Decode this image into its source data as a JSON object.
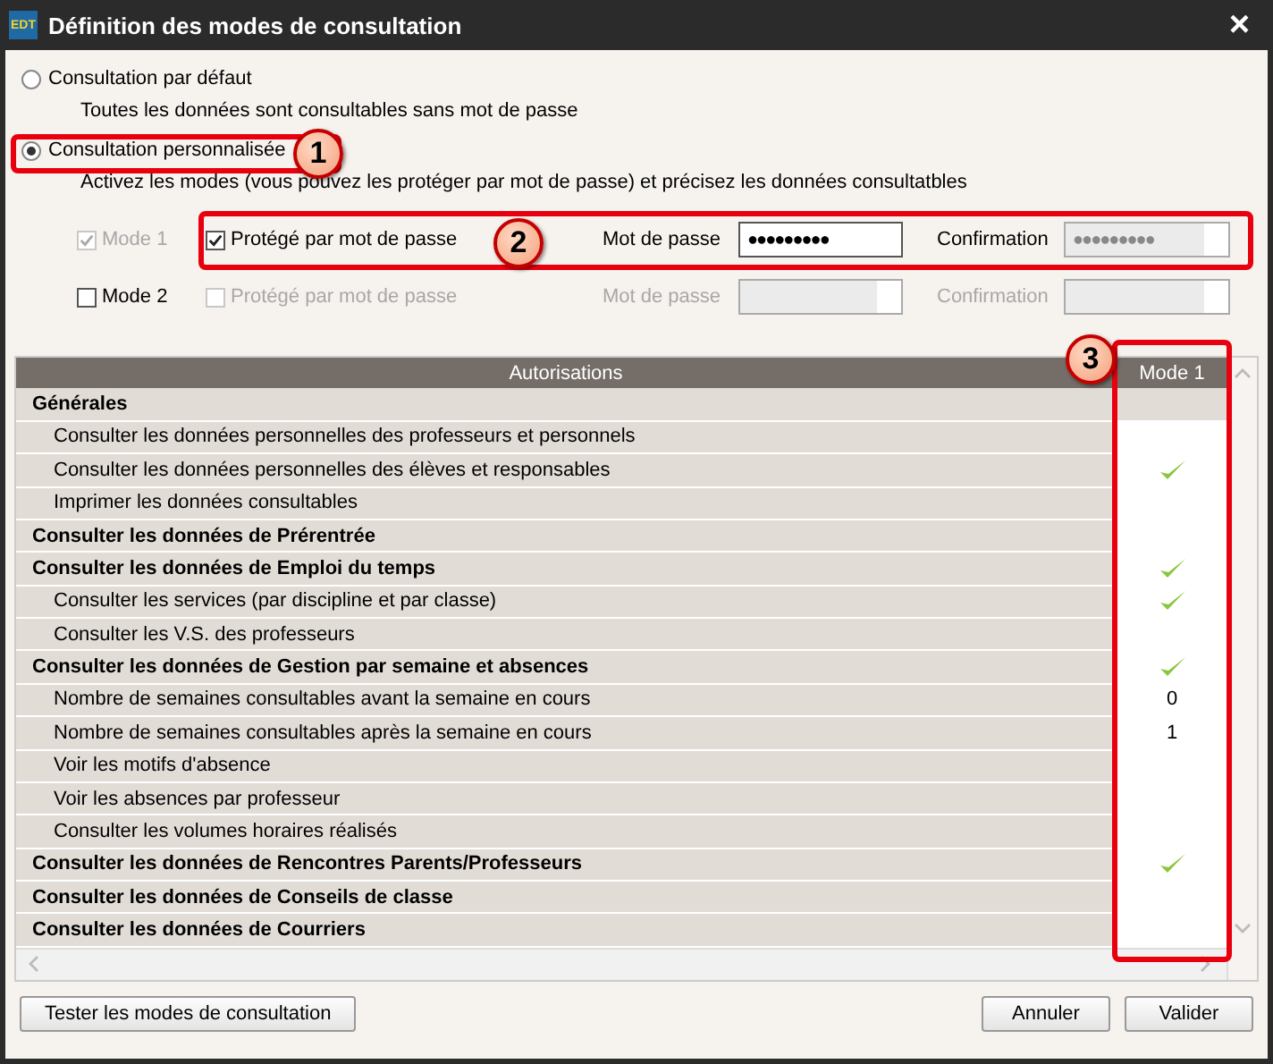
{
  "window": {
    "app_badge": "EDT",
    "title": "Définition des modes de consultation",
    "close": "×"
  },
  "options": [
    {
      "label": "Consultation par défaut",
      "selected": false,
      "description": "Toutes les données sont consultables sans mot de passe"
    },
    {
      "label": "Consultation personnalisée",
      "selected": true,
      "description": "Activez les modes (vous pouvez les protéger par mot de passe) et précisez les données consultatbles"
    }
  ],
  "modes": [
    {
      "label": "Mode 1",
      "checked": true,
      "disabled": true,
      "protect_label": "Protégé par mot de passe",
      "protected": true,
      "protect_disabled": false,
      "password_label": "Mot de passe",
      "password": "●●●●●●●●●",
      "password_disabled": false,
      "confirm_label": "Confirmation",
      "confirm": "●●●●●●●●●",
      "confirm_disabled": true
    },
    {
      "label": "Mode 2",
      "checked": false,
      "disabled": false,
      "protect_label": "Protégé par mot de passe",
      "protected": false,
      "protect_disabled": true,
      "password_label": "Mot de passe",
      "password_disabled": true,
      "confirm_label": "Confirmation",
      "confirm_disabled": true
    }
  ],
  "table": {
    "columns": [
      "Autorisations",
      "Mode 1"
    ],
    "rows": [
      {
        "kind": "group",
        "label": "Générales",
        "checked": false
      },
      {
        "kind": "item",
        "label": "Consulter les données personnelles des professeurs et personnels",
        "checked": false
      },
      {
        "kind": "item",
        "label": "Consulter les données personnelles des élèves et responsables",
        "checked": true
      },
      {
        "kind": "item",
        "label": "Imprimer les données consultables",
        "checked": false
      },
      {
        "kind": "group",
        "label": "Consulter les données de Prérentrée",
        "checked": false
      },
      {
        "kind": "group",
        "label": "Consulter les données de Emploi du temps",
        "checked": true
      },
      {
        "kind": "item",
        "label": "Consulter les services (par discipline et par classe)",
        "checked": true
      },
      {
        "kind": "item",
        "label": "Consulter les V.S. des professeurs",
        "checked": false
      },
      {
        "kind": "group",
        "label": "Consulter les données de Gestion par semaine et absences",
        "checked": true
      },
      {
        "kind": "item",
        "label": "Nombre de semaines consultables avant la semaine en cours",
        "checked": false,
        "value": "0"
      },
      {
        "kind": "item",
        "label": "Nombre de semaines consultables après la semaine en cours",
        "checked": false,
        "value": "1"
      },
      {
        "kind": "item",
        "label": "Voir les motifs d'absence",
        "checked": false
      },
      {
        "kind": "item",
        "label": "Voir les absences par professeur",
        "checked": false
      },
      {
        "kind": "item",
        "label": "Consulter les volumes horaires réalisés",
        "checked": false
      },
      {
        "kind": "group",
        "label": "Consulter les données de Rencontres Parents/Professeurs",
        "checked": true
      },
      {
        "kind": "group",
        "label": "Consulter les données de Conseils de classe",
        "checked": false
      },
      {
        "kind": "group",
        "label": "Consulter les données de Courriers",
        "checked": false
      }
    ]
  },
  "buttons": [
    "Tester les modes de consultation",
    "Annuler",
    "Valider"
  ],
  "callouts": [
    "1",
    "2",
    "3"
  ]
}
